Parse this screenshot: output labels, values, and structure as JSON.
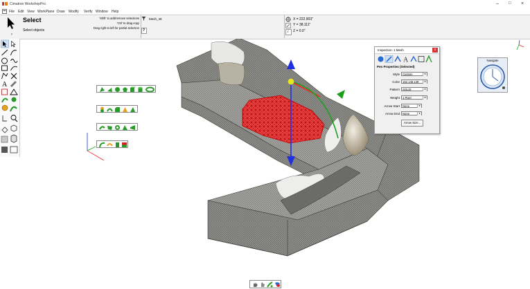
{
  "app": {
    "title": "Cimatron WorkshopPro"
  },
  "menu": [
    "File",
    "Edit",
    "View",
    "WorkPlane",
    "Draw",
    "Modify",
    "Verify",
    "Window",
    "Help"
  ],
  "command": {
    "name": "Select",
    "subtitle": "Select objects",
    "hints": [
      "'Shift' to add/remove selections",
      "'Ctrl' to drag copy",
      "Drag right to left for partial selection"
    ],
    "object_name": "Mesh_48",
    "help_btn": "?",
    "coords": {
      "x": "X = 222.903\"",
      "y": "Y = 38.111\"",
      "z": "Z = 0.0\""
    },
    "info_btn": "i"
  },
  "inspection": {
    "title": "Inspection: 1 Mesh",
    "section": "Pen Properties (Selected)",
    "fields": [
      {
        "label": "Style",
        "value": "Custom"
      },
      {
        "label": "Color",
        "value": "152,148,139"
      },
      {
        "label": "Pattern",
        "value": "SOLID"
      },
      {
        "label": "Weight",
        "value": "1 Pixel"
      },
      {
        "label": "Arrow Start",
        "value": "None"
      },
      {
        "label": "Arrow End",
        "value": "None"
      }
    ],
    "arrow_size_btn": "Arrow Size...",
    "close": "x"
  },
  "navigate": {
    "title": "Navigate"
  },
  "colors": {
    "mesh": "#8a8a87",
    "selection": "#e02020",
    "axis_x": "#ff2020",
    "axis_y": "#1ca01c",
    "axis_z": "#2030e0"
  }
}
